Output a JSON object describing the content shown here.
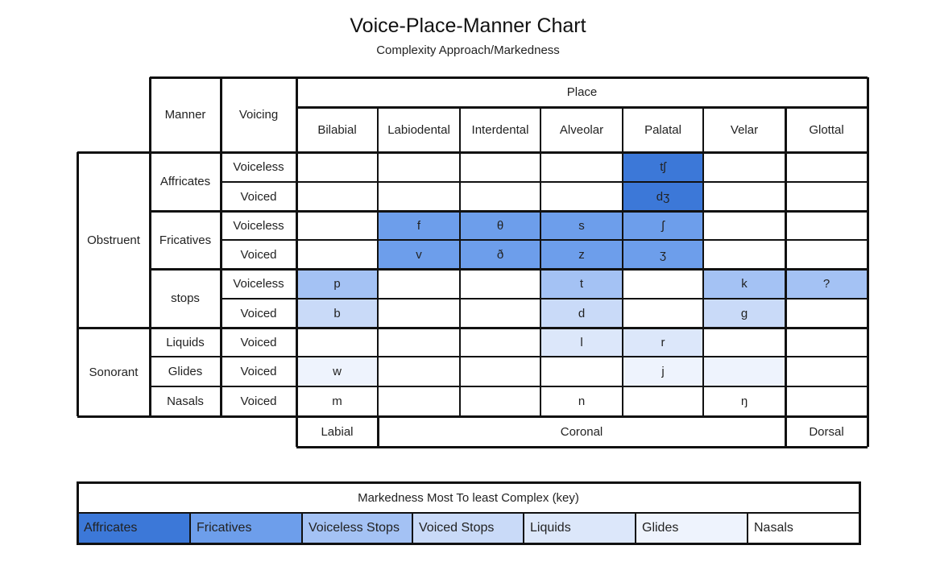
{
  "title": "Voice-Place-Manner Chart",
  "subtitle": "Complexity Approach/Markedness",
  "colors": {
    "affricates": "#3c78d8",
    "fricatives": "#6d9eeb",
    "voiceless_stops": "#a4c2f4",
    "voiced_stops": "#c9daf8",
    "liquids": "#dce7fa",
    "glides": "#eef3fd",
    "nasals": "#ffffff",
    "border": "#111111"
  },
  "chart_data": {
    "type": "table",
    "title": "Voice-Place-Manner Chart",
    "subtitle": "Complexity Approach/Markedness",
    "header": {
      "manner": "Manner",
      "voicing": "Voicing",
      "place": "Place"
    },
    "places": [
      "Bilabial",
      "Labiodental",
      "Interdental",
      "Alveolar",
      "Palatal",
      "Velar",
      "Glottal"
    ],
    "groups": [
      {
        "label": "Obstruent",
        "manners": [
          {
            "label": "Affricates",
            "rows": [
              {
                "voicing": "Voiceless",
                "cells": [
                  "",
                  "",
                  "",
                  "",
                  "tʃ",
                  "",
                  ""
                ],
                "shade": [
                  "none",
                  "none",
                  "none",
                  "none",
                  "affricates",
                  "none",
                  "none"
                ]
              },
              {
                "voicing": "Voiced",
                "cells": [
                  "",
                  "",
                  "",
                  "",
                  "dʒ",
                  "",
                  ""
                ],
                "shade": [
                  "none",
                  "none",
                  "none",
                  "none",
                  "affricates",
                  "none",
                  "none"
                ]
              }
            ]
          },
          {
            "label": "Fricatives",
            "rows": [
              {
                "voicing": "Voiceless",
                "cells": [
                  "",
                  "f",
                  "θ",
                  "s",
                  "ʃ",
                  "",
                  ""
                ],
                "shade": [
                  "none",
                  "fricatives",
                  "fricatives",
                  "fricatives",
                  "fricatives",
                  "none",
                  "none"
                ]
              },
              {
                "voicing": "Voiced",
                "cells": [
                  "",
                  "v",
                  "ð",
                  "z",
                  "ʒ",
                  "",
                  ""
                ],
                "shade": [
                  "none",
                  "fricatives",
                  "fricatives",
                  "fricatives",
                  "fricatives",
                  "none",
                  "none"
                ]
              }
            ]
          },
          {
            "label": "stops",
            "rows": [
              {
                "voicing": "Voiceless",
                "cells": [
                  "p",
                  "",
                  "",
                  "t",
                  "",
                  "k",
                  "?"
                ],
                "shade": [
                  "voiceless_stops",
                  "none",
                  "none",
                  "voiceless_stops",
                  "none",
                  "voiceless_stops",
                  "voiceless_stops"
                ]
              },
              {
                "voicing": "Voiced",
                "cells": [
                  "b",
                  "",
                  "",
                  "d",
                  "",
                  "g",
                  ""
                ],
                "shade": [
                  "voiced_stops",
                  "none",
                  "none",
                  "voiced_stops",
                  "none",
                  "voiced_stops",
                  "none"
                ]
              }
            ]
          }
        ]
      },
      {
        "label": "Sonorant",
        "manners": [
          {
            "label": "Liquids",
            "rows": [
              {
                "voicing": "Voiced",
                "cells": [
                  "",
                  "",
                  "",
                  "l",
                  "r",
                  "",
                  ""
                ],
                "shade": [
                  "none",
                  "none",
                  "none",
                  "liquids",
                  "liquids",
                  "none",
                  "none"
                ]
              }
            ]
          },
          {
            "label": "Glides",
            "rows": [
              {
                "voicing": "Voiced",
                "cells": [
                  "w",
                  "",
                  "",
                  "",
                  "j",
                  "",
                  ""
                ],
                "shade": [
                  "glides",
                  "none",
                  "none",
                  "none",
                  "glides",
                  "glides",
                  "none"
                ]
              }
            ]
          },
          {
            "label": "Nasals",
            "rows": [
              {
                "voicing": "Voiced",
                "cells": [
                  "m",
                  "",
                  "",
                  "n",
                  "",
                  "ŋ",
                  ""
                ],
                "shade": [
                  "none",
                  "none",
                  "none",
                  "none",
                  "none",
                  "none",
                  "none"
                ]
              }
            ]
          }
        ]
      }
    ],
    "place_groups": [
      {
        "label": "Labial",
        "span": [
          "Bilabial"
        ]
      },
      {
        "label": "Coronal",
        "span": [
          "Labiodental",
          "Interdental",
          "Alveolar",
          "Palatal",
          "Velar"
        ]
      },
      {
        "label": "Dorsal",
        "span": [
          "Glottal"
        ]
      }
    ]
  },
  "key": {
    "title": "Markedness Most To least Complex (key)",
    "items": [
      {
        "label": "Affricates",
        "shade": "affricates"
      },
      {
        "label": "Fricatives",
        "shade": "fricatives"
      },
      {
        "label": "Voiceless Stops",
        "shade": "voiceless_stops"
      },
      {
        "label": "Voiced Stops",
        "shade": "voiced_stops"
      },
      {
        "label": "Liquids",
        "shade": "liquids"
      },
      {
        "label": "Glides",
        "shade": "glides"
      },
      {
        "label": "Nasals",
        "shade": "nasals"
      }
    ]
  }
}
